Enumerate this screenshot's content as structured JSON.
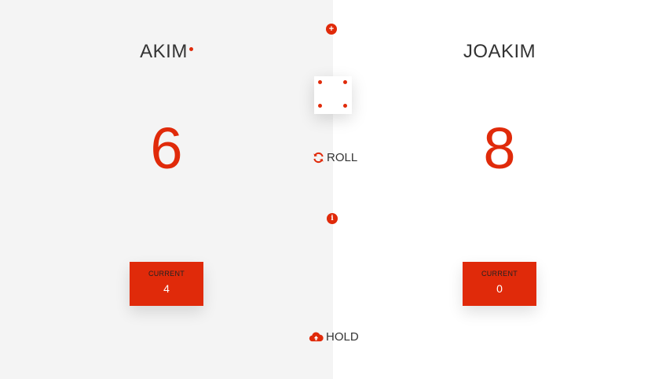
{
  "players": [
    {
      "name": "AKIM",
      "score": "6",
      "current_label": "CURRENT",
      "current_value": "4",
      "active": true
    },
    {
      "name": "JOAKIM",
      "score": "8",
      "current_label": "CURRENT",
      "current_value": "0",
      "active": false
    }
  ],
  "controls": {
    "new_game_icon": "plus-icon",
    "roll_label": "ROLL",
    "roll_icon": "refresh-icon",
    "hold_label": "HOLD",
    "hold_icon": "cloud-upload-icon",
    "info_icon": "info-icon"
  },
  "dice": {
    "value": 4
  },
  "colors": {
    "accent": "#e02a0a",
    "left_panel": "#f4f4f4",
    "right_panel": "#ffffff"
  }
}
